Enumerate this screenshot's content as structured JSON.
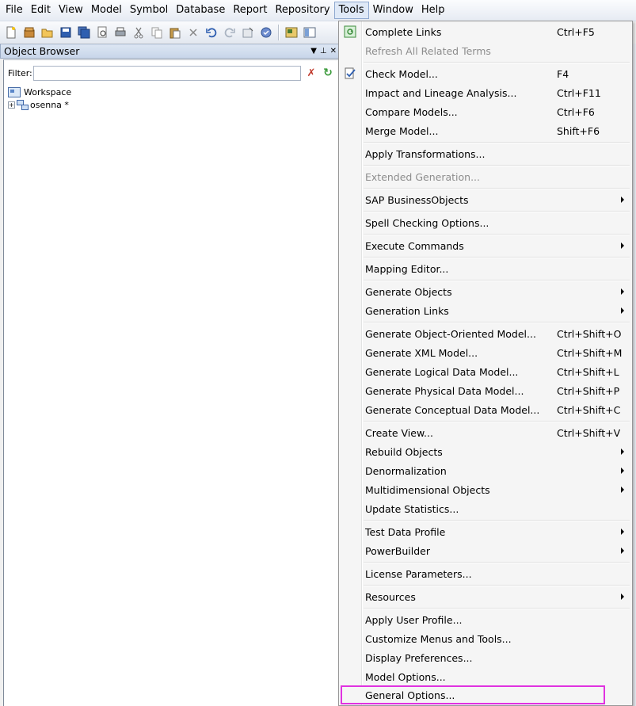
{
  "menubar": {
    "items": [
      "File",
      "Edit",
      "View",
      "Model",
      "Symbol",
      "Database",
      "Report",
      "Repository",
      "Tools",
      "Window",
      "Help"
    ]
  },
  "toolbar": {
    "buttons": [
      "new-icon",
      "new-project-icon",
      "open-icon",
      "save-icon",
      "save-all-icon",
      "print-preview-icon",
      "print-icon",
      "cut-icon",
      "copy-icon",
      "paste-icon",
      "delete-icon",
      "undo-icon",
      "redo-icon",
      "properties-icon",
      "check-model-icon",
      "workspace-icon",
      "browser-icon"
    ]
  },
  "object_browser": {
    "title": "Object Browser",
    "filter_label": "Filter:",
    "filter_value": "",
    "tree": {
      "root": "Workspace",
      "children": [
        "osenna *"
      ]
    }
  },
  "tools_menu": {
    "items": [
      {
        "label": "Complete Links",
        "shortcut": "Ctrl+F5",
        "icon": "complete-links-icon"
      },
      {
        "label": "Refresh All Related Terms",
        "shortcut": "",
        "disabled": true
      },
      {
        "label": "Check Model...",
        "shortcut": "F4",
        "icon": "check-model-icon"
      },
      {
        "label": "Impact and Lineage Analysis...",
        "shortcut": "Ctrl+F11"
      },
      {
        "label": "Compare Models...",
        "shortcut": "Ctrl+F6"
      },
      {
        "label": "Merge Model...",
        "shortcut": "Shift+F6"
      },
      {
        "label": "Apply Transformations...",
        "shortcut": ""
      },
      {
        "label": "Extended Generation...",
        "shortcut": "",
        "disabled": true
      },
      {
        "label": "SAP BusinessObjects",
        "shortcut": "",
        "submenu": true
      },
      {
        "label": "Spell Checking Options...",
        "shortcut": ""
      },
      {
        "label": "Execute Commands",
        "shortcut": "",
        "submenu": true
      },
      {
        "label": "Mapping Editor...",
        "shortcut": ""
      },
      {
        "label": "Generate Objects",
        "shortcut": "",
        "submenu": true
      },
      {
        "label": "Generation Links",
        "shortcut": "",
        "submenu": true
      },
      {
        "label": "Generate Object-Oriented Model...",
        "shortcut": "Ctrl+Shift+O"
      },
      {
        "label": "Generate XML Model...",
        "shortcut": "Ctrl+Shift+M"
      },
      {
        "label": "Generate Logical Data Model...",
        "shortcut": "Ctrl+Shift+L"
      },
      {
        "label": "Generate Physical Data Model...",
        "shortcut": "Ctrl+Shift+P"
      },
      {
        "label": "Generate Conceptual Data Model...",
        "shortcut": "Ctrl+Shift+C"
      },
      {
        "label": "Create View...",
        "shortcut": "Ctrl+Shift+V"
      },
      {
        "label": "Rebuild Objects",
        "shortcut": "",
        "submenu": true
      },
      {
        "label": "Denormalization",
        "shortcut": "",
        "submenu": true
      },
      {
        "label": "Multidimensional Objects",
        "shortcut": "",
        "submenu": true
      },
      {
        "label": "Update Statistics...",
        "shortcut": ""
      },
      {
        "label": "Test Data Profile",
        "shortcut": "",
        "submenu": true
      },
      {
        "label": "PowerBuilder",
        "shortcut": "",
        "submenu": true
      },
      {
        "label": "License Parameters...",
        "shortcut": ""
      },
      {
        "label": "Resources",
        "shortcut": "",
        "submenu": true
      },
      {
        "label": "Apply User Profile...",
        "shortcut": ""
      },
      {
        "label": "Customize Menus and Tools...",
        "shortcut": ""
      },
      {
        "label": "Display Preferences...",
        "shortcut": ""
      },
      {
        "label": "Model Options...",
        "shortcut": ""
      },
      {
        "label": "General Options...",
        "shortcut": "",
        "highlighted": true
      }
    ]
  }
}
